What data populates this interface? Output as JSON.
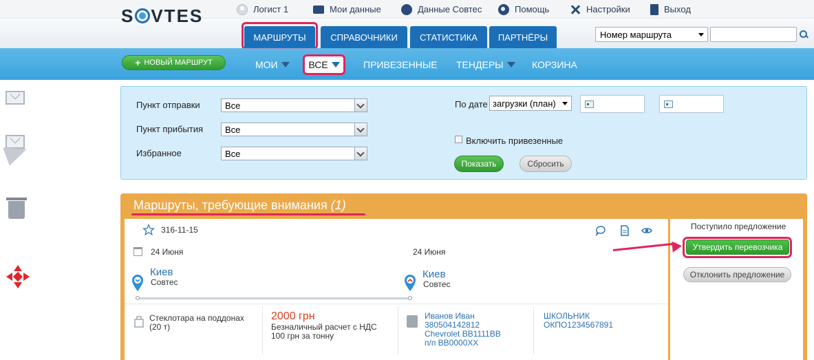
{
  "topbar": {
    "user": "Логист 1",
    "my_data": "Мои данные",
    "company_data": "Данные Совтес",
    "help": "Помощь",
    "settings": "Настройки",
    "logout": "Выход"
  },
  "header": {
    "logo": "SOVTES",
    "tabs": [
      "МАРШРУТЫ",
      "СПРАВОЧНИКИ",
      "СТАТИСТИКА",
      "ПАРТНЁРЫ"
    ],
    "active_tab": "МАРШРУТЫ",
    "route_select": "Номер маршрута",
    "search_value": ""
  },
  "nav": {
    "new_route": "НОВЫЙ МАРШРУТ",
    "items": [
      "МОИ",
      "ВСЕ",
      "ПРИВЕЗЕННЫЕ",
      "ТЕНДЕРЫ",
      "КОРЗИНА"
    ],
    "active": "ВСЕ"
  },
  "filter": {
    "departure_label": "Пункт отправки",
    "departure_value": "Все",
    "arrival_label": "Пункт прибытия",
    "arrival_value": "Все",
    "favorite_label": "Избранное",
    "favorite_value": "Все",
    "by_date_label": "По дате",
    "date_type": "загрузки (план)",
    "date_from": "",
    "date_to": "",
    "include_delivered": "Включить привезенные",
    "include_delivered_checked": false,
    "show_button": "Показать",
    "reset_button": "Сбросить"
  },
  "attention": {
    "title": "Маршруты, требующие внимания",
    "count": "(1)",
    "route": {
      "id": "316-11-15",
      "date_from": "24 Июня",
      "date_to": "24 Июня",
      "from_city": "Киев",
      "from_company": "Совтес",
      "to_city": "Киев",
      "to_company": "Совтес",
      "cargo": "Стеклотара на поддонах",
      "cargo_weight": "(20 т)",
      "price": "2000 грн",
      "payment": "Безналичный расчет с НДС",
      "price_per_ton": "100 грн за тонну",
      "driver_name": "Иванов Иван",
      "driver_phone": "380504142812",
      "vehicle": "Chevrolet BB1111BB",
      "trailer": "п/п BB0000XX",
      "carrier": "ШКОЛЬНИК",
      "okpo": "ОКПО1234567891"
    },
    "offer": {
      "status": "Поступило предложение",
      "approve_button": "Утвердить перевозчика",
      "reject_button": "Отклонить предложение"
    }
  },
  "colors": {
    "primary_blue": "#1b6fb8",
    "nav_blue": "#3aa3dd",
    "green": "#2f9a2e",
    "orange": "#eca94a",
    "highlight": "#e0245e"
  }
}
